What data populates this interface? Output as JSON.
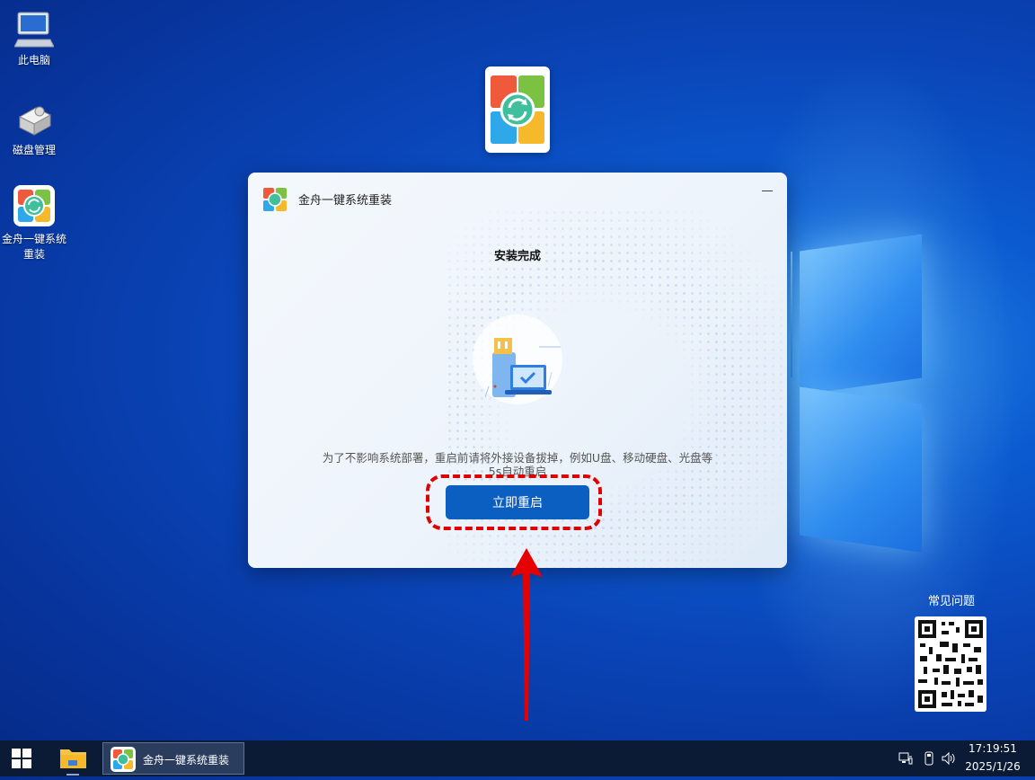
{
  "desktop": {
    "icons": [
      {
        "label": "此电脑"
      },
      {
        "label": "磁盘管理"
      },
      {
        "label_line1": "金舟一键系统",
        "label_line2": "重装"
      }
    ]
  },
  "dialog": {
    "title": "金舟一键系统重装",
    "heading": "安装完成",
    "message_line1": "为了不影响系统部署，重启前请将外接设备拔掉，例如U盘、移动硬盘、光盘等",
    "message_line2": "5s自动重启",
    "restart_button": "立即重启"
  },
  "faq": {
    "label": "常见问题"
  },
  "taskbar": {
    "app_label": "金舟一键系统重装",
    "time": "17:19:51",
    "date": "2025/1/26"
  },
  "colors": {
    "accent": "#0a5fc0",
    "highlight": "#e00000",
    "taskbar": "#0b1a35"
  }
}
